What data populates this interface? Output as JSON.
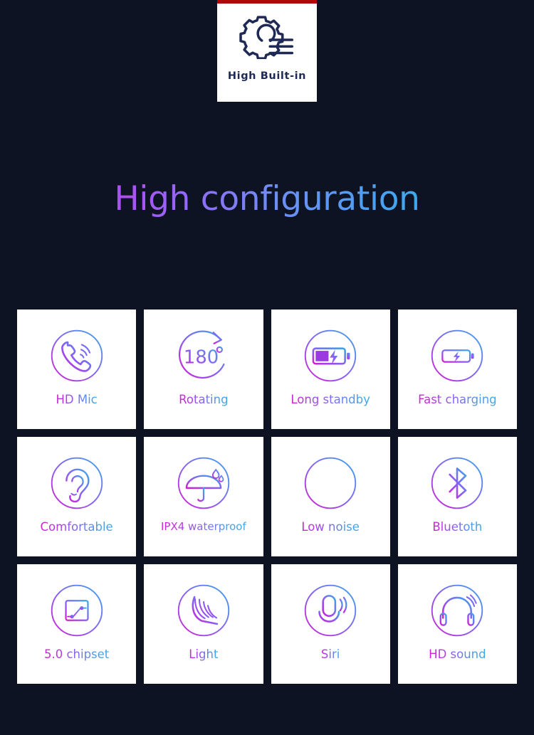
{
  "page": {
    "background_color": "#0e1324",
    "card_background": "#ffffff",
    "accent_start": "#d11fd1",
    "accent_end": "#3aa8e8",
    "stripe_color": "#b00808"
  },
  "badge": {
    "icon": "gear-settings-icon",
    "label": "High Built-in",
    "label_color": "#1e2a55"
  },
  "heading": {
    "text": "High configuration"
  },
  "features": [
    {
      "label": "HD Mic",
      "icon": "phone-call-icon"
    },
    {
      "label": "Rotating",
      "icon": "rotate-180-degrees-icon"
    },
    {
      "label": "Long standby",
      "icon": "battery-full-charge-icon"
    },
    {
      "label": "Fast charging",
      "icon": "battery-bolt-icon"
    },
    {
      "label": "Comfortable",
      "icon": "ear-icon"
    },
    {
      "label": "IPX4 waterproof",
      "icon": "umbrella-raindrops-icon"
    },
    {
      "label": "Low noise",
      "icon": "sound-wave-icon"
    },
    {
      "label": "Bluetoth",
      "icon": "bluetooth-icon"
    },
    {
      "label": "5.0 chipset",
      "icon": "chip-circuit-icon"
    },
    {
      "label": "Light",
      "icon": "feather-icon"
    },
    {
      "label": "Siri",
      "icon": "microphone-voice-icon"
    },
    {
      "label": "HD sound",
      "icon": "headphones-icon"
    }
  ]
}
